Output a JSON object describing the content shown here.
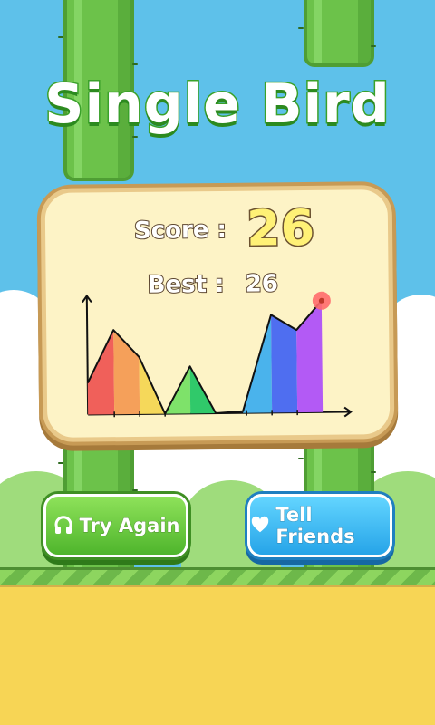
{
  "game": {
    "title": "Single Bird",
    "score_label": "Score :",
    "score_value": "26",
    "best_label": "Best :",
    "best_value": "26"
  },
  "buttons": {
    "try_again": "Try Again",
    "tell_friends": "Tell Friends"
  },
  "chart_data": {
    "type": "area",
    "title": "",
    "xlabel": "",
    "ylabel": "",
    "series": [
      {
        "values": [
          0,
          26
        ]
      }
    ]
  },
  "colors": {
    "sky": "#5ec1ea",
    "pipe": "#6cc24a",
    "ground": "#f7d555",
    "try_button": "#5cc236",
    "tell_button": "#36b4f0",
    "title_outline": "#3aa12a"
  },
  "icons": {
    "try_again": "restart-icon",
    "tell_friends": "heart-icon"
  }
}
